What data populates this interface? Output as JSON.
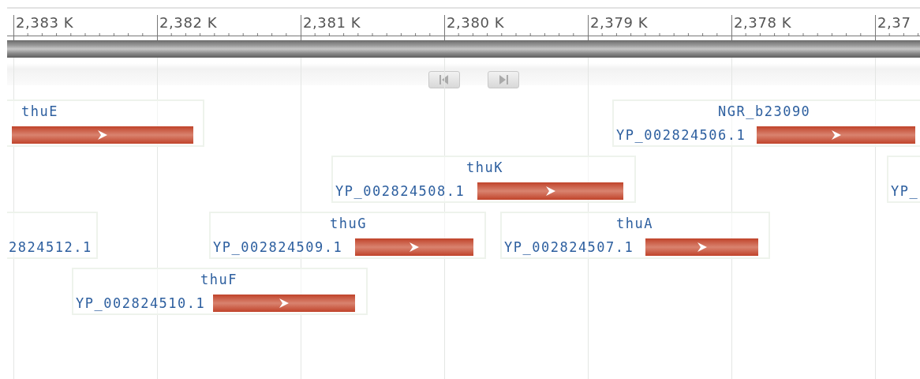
{
  "ruler": {
    "ticks": [
      "2,383 K",
      "2,382 K",
      "2,381 K",
      "2,380 K",
      "2,379 K",
      "2,378 K",
      "2,37"
    ]
  },
  "features": [
    {
      "name": "thuE"
    },
    {
      "name": "NGR_b23090",
      "locus": "YP_002824506.1"
    },
    {
      "name": "thuK",
      "locus": "YP_002824508.1"
    },
    {
      "locus": "YP_"
    },
    {
      "locus": "2824512.1"
    },
    {
      "name": "thuG",
      "locus": "YP_002824509.1"
    },
    {
      "name": "thuA",
      "locus": "YP_002824507.1"
    },
    {
      "name": "thuF",
      "locus": "YP_002824510.1"
    }
  ]
}
